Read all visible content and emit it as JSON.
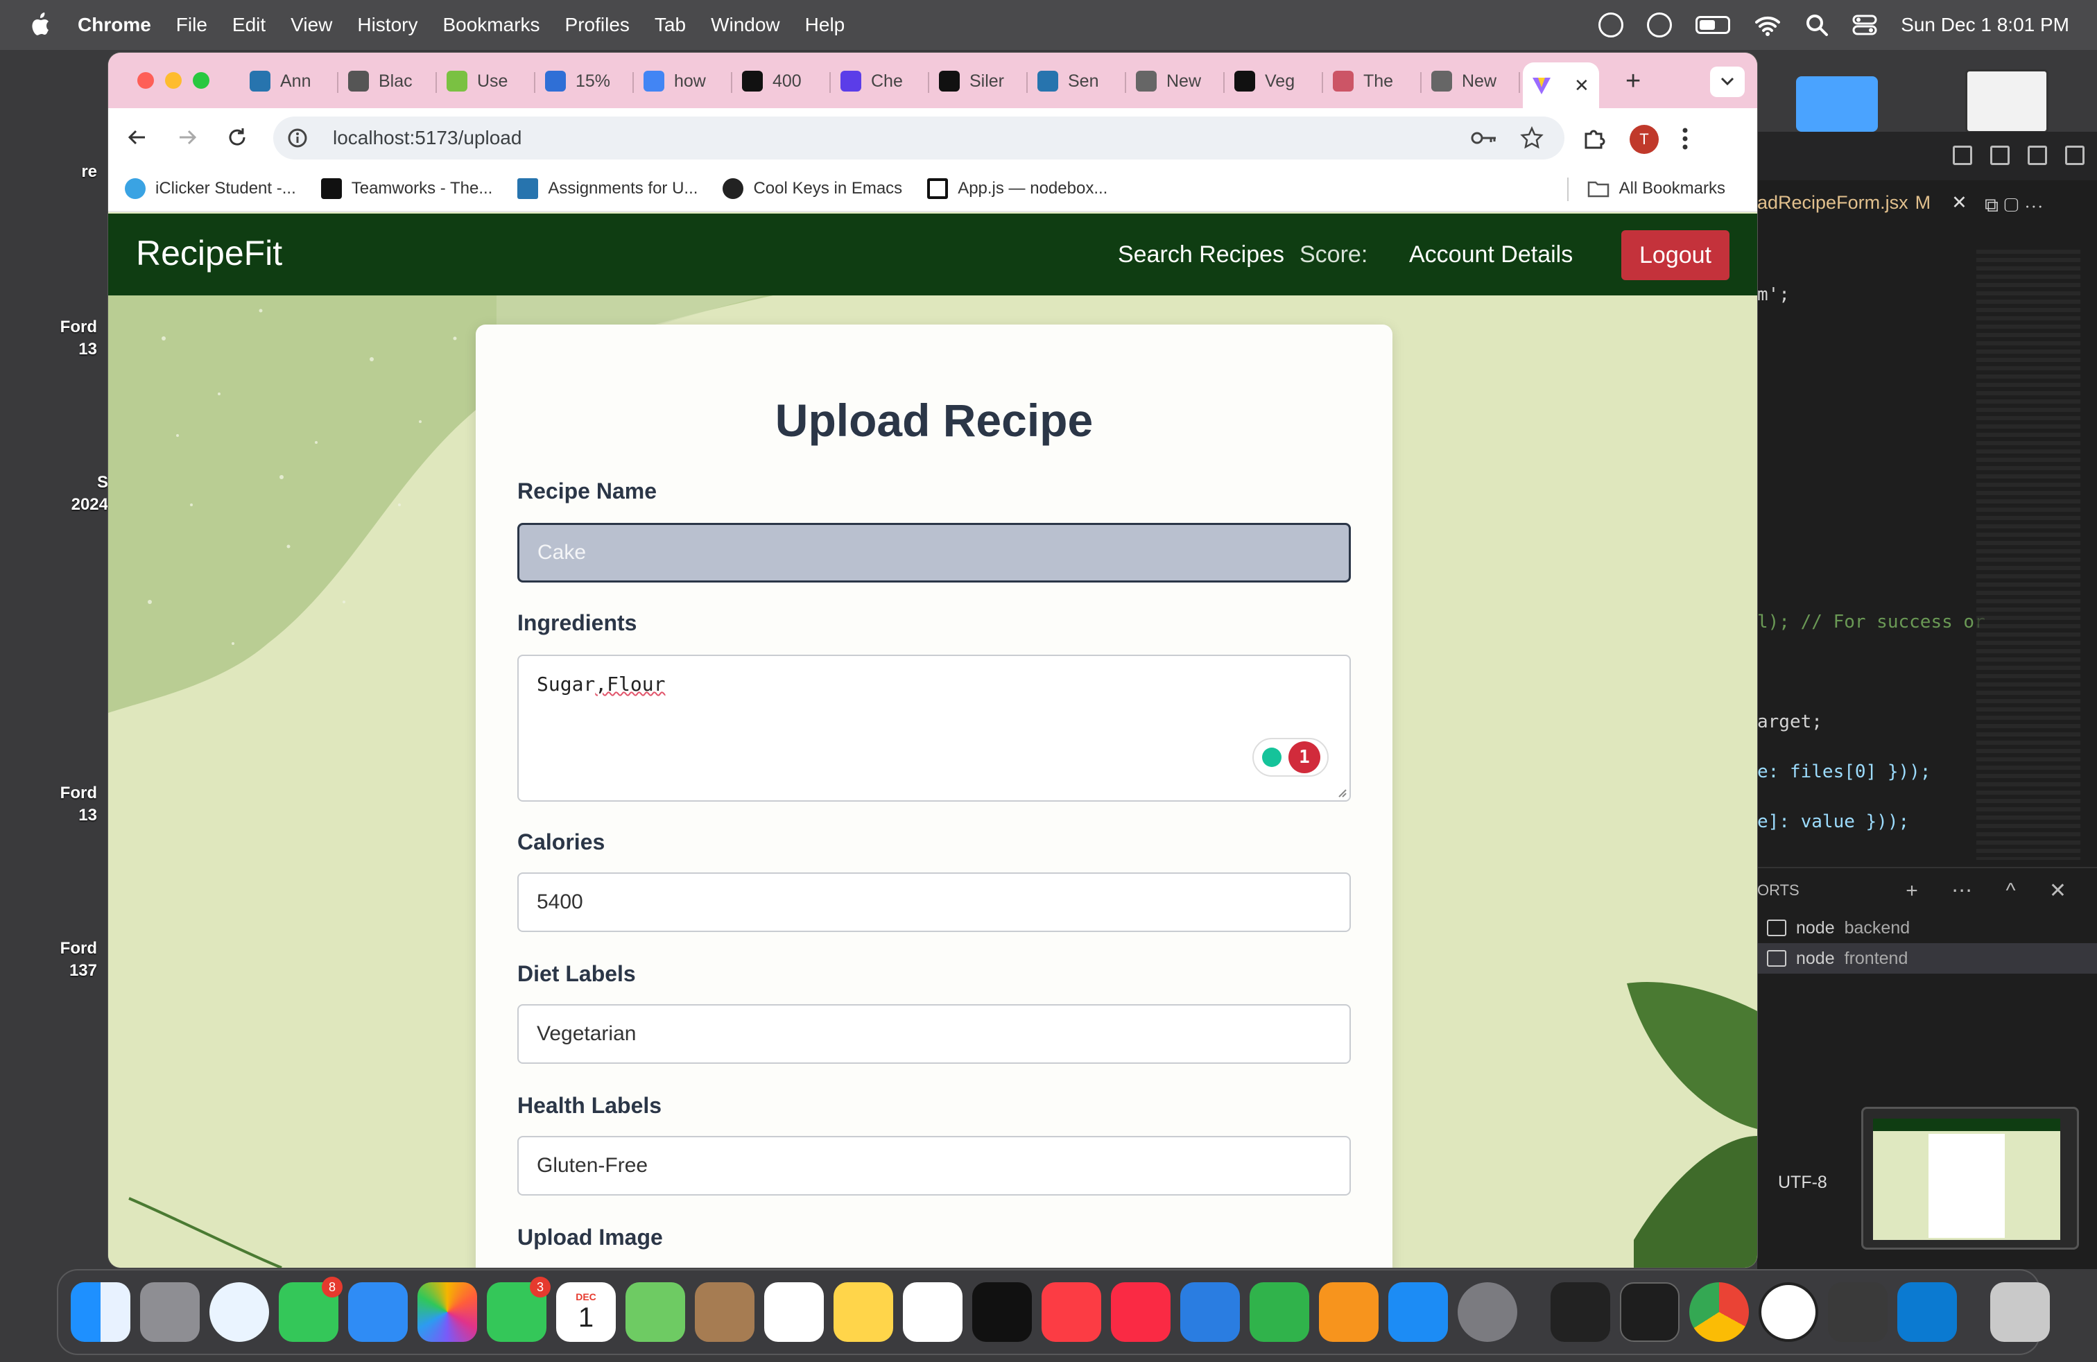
{
  "menubar": {
    "app": "Chrome",
    "items": [
      "File",
      "Edit",
      "View",
      "History",
      "Bookmarks",
      "Profiles",
      "Tab",
      "Window",
      "Help"
    ],
    "datetime": "Sun Dec 1  8:01 PM"
  },
  "desktop": {
    "labels": [
      "re",
      "Ford\n13",
      "S\n2024",
      "Ford\n13",
      "Ford\n137"
    ]
  },
  "editor": {
    "tab_label": "adRecipeForm.jsx",
    "tab_modified": "M",
    "code_lines": [
      {
        "text": "m';"
      },
      {
        "text": "l); // For success or"
      },
      {
        "text": "arget;"
      },
      {
        "text": "e: files[0] }));"
      },
      {
        "text": "e]: value }));"
      }
    ],
    "panel_title": "ORTS",
    "terminals": [
      {
        "name": "node",
        "label": "backend"
      },
      {
        "name": "node",
        "label": "frontend"
      }
    ],
    "encoding": "UTF-8"
  },
  "browser": {
    "tabs": [
      "Ann",
      "Blac",
      "Use",
      "15%",
      "how",
      "400",
      "Che",
      "Siler",
      "Sen",
      "New",
      "Veg",
      "The",
      "New"
    ],
    "url": "localhost:5173/upload",
    "profile_initial": "T",
    "bookmarks": [
      "iClicker Student -...",
      "Teamworks - The...",
      "Assignments for U...",
      "Cool Keys in Emacs",
      "App.js — nodebox..."
    ],
    "all_bookmarks": "All Bookmarks"
  },
  "app": {
    "brand": "RecipeFit",
    "nav": {
      "search": "Search Recipes",
      "score": "Score:",
      "account": "Account Details",
      "logout": "Logout"
    },
    "form": {
      "title": "Upload Recipe",
      "recipe_name_label": "Recipe Name",
      "recipe_name_value": "Cake",
      "ingredients_label": "Ingredients",
      "ingredients_value_a": "Sugar",
      "ingredients_value_b": ",Flour",
      "grammarly_count": "1",
      "calories_label": "Calories",
      "calories_value": "5400",
      "diet_label": "Diet Labels",
      "diet_value": "Vegetarian",
      "health_label": "Health Labels",
      "health_value": "Gluten-Free",
      "image_label": "Upload Image"
    }
  },
  "dock": {
    "messages_badge": "8",
    "facetime_badge": "3",
    "calendar_month": "DEC",
    "calendar_day": "1"
  }
}
